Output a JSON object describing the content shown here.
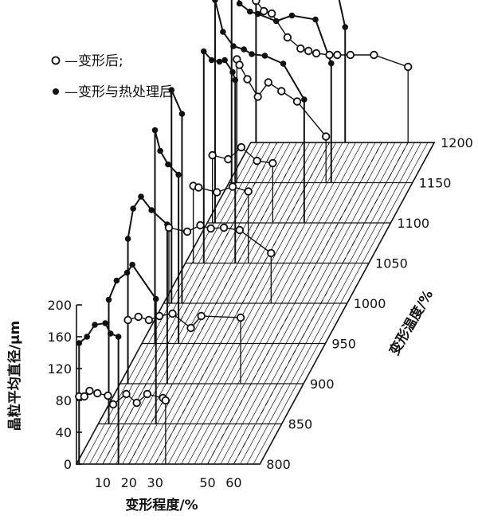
{
  "chart_data": {
    "type": "line",
    "style": "3d-waterfall",
    "grid": true,
    "legend_position": "top-left",
    "ylabel": "晶粒平均直径/μm",
    "xlabel": "变形程度/%",
    "zlabel": "变形温度/%",
    "x_ticks": [
      10,
      20,
      30,
      50,
      60
    ],
    "x_tick_labels": [
      "10",
      "20",
      "30",
      "50",
      "60"
    ],
    "y_ticks": [
      0,
      40,
      80,
      120,
      160,
      200
    ],
    "y_tick_labels": [
      "0",
      "40",
      "80",
      "120",
      "160",
      "200"
    ],
    "z_ticks": [
      800,
      850,
      900,
      950,
      1000,
      1050,
      1100,
      1150,
      1200
    ],
    "z_tick_labels": [
      "800",
      "850",
      "900",
      "950",
      "1000",
      "1050",
      "1100",
      "1150",
      "1200"
    ],
    "xlim": [
      0,
      70
    ],
    "ylim": [
      0,
      200
    ],
    "zlim": [
      800,
      1200
    ],
    "series": [
      {
        "name": "—变形后;",
        "marker": "open-circle",
        "points": [
          {
            "T": 800,
            "eps": 1,
            "d": 85
          },
          {
            "T": 800,
            "eps": 3,
            "d": 85
          },
          {
            "T": 800,
            "eps": 5,
            "d": 92
          },
          {
            "T": 800,
            "eps": 8,
            "d": 89
          },
          {
            "T": 800,
            "eps": 12,
            "d": 86
          },
          {
            "T": 800,
            "eps": 14,
            "d": 75
          },
          {
            "T": 800,
            "eps": 19,
            "d": 88
          },
          {
            "T": 800,
            "eps": 23,
            "d": 77
          },
          {
            "T": 800,
            "eps": 27,
            "d": 88
          },
          {
            "T": 800,
            "eps": 33,
            "d": 83
          },
          {
            "T": 800,
            "eps": 34,
            "d": 80
          },
          {
            "T": 900,
            "eps": 3,
            "d": 80
          },
          {
            "T": 900,
            "eps": 7,
            "d": 84
          },
          {
            "T": 900,
            "eps": 11,
            "d": 80
          },
          {
            "T": 900,
            "eps": 15,
            "d": 85
          },
          {
            "T": 900,
            "eps": 20,
            "d": 88
          },
          {
            "T": 900,
            "eps": 27,
            "d": 70
          },
          {
            "T": 900,
            "eps": 31,
            "d": 85
          },
          {
            "T": 900,
            "eps": 46,
            "d": 83
          },
          {
            "T": 1000,
            "eps": 2,
            "d": 95
          },
          {
            "T": 1000,
            "eps": 9,
            "d": 90
          },
          {
            "T": 1000,
            "eps": 14,
            "d": 98
          },
          {
            "T": 1000,
            "eps": 18,
            "d": 94
          },
          {
            "T": 1000,
            "eps": 23,
            "d": 95
          },
          {
            "T": 1000,
            "eps": 29,
            "d": 92
          },
          {
            "T": 1000,
            "eps": 41,
            "d": 63
          },
          {
            "T": 1050,
            "eps": 3,
            "d": 97
          },
          {
            "T": 1050,
            "eps": 5,
            "d": 95
          },
          {
            "T": 1050,
            "eps": 12,
            "d": 89
          },
          {
            "T": 1050,
            "eps": 18,
            "d": 96
          },
          {
            "T": 1050,
            "eps": 24,
            "d": 90
          },
          {
            "T": 1100,
            "eps": 2,
            "d": 85
          },
          {
            "T": 1100,
            "eps": 8,
            "d": 80
          },
          {
            "T": 1100,
            "eps": 13,
            "d": 95
          },
          {
            "T": 1100,
            "eps": 19,
            "d": 78
          },
          {
            "T": 1100,
            "eps": 25,
            "d": 75
          },
          {
            "T": 1150,
            "eps": 3,
            "d": 155
          },
          {
            "T": 1150,
            "eps": 4,
            "d": 148
          },
          {
            "T": 1150,
            "eps": 7,
            "d": 130
          },
          {
            "T": 1150,
            "eps": 11,
            "d": 108
          },
          {
            "T": 1150,
            "eps": 15,
            "d": 126
          },
          {
            "T": 1150,
            "eps": 20,
            "d": 115
          },
          {
            "T": 1150,
            "eps": 26,
            "d": 102
          },
          {
            "T": 1150,
            "eps": 37,
            "d": 58
          },
          {
            "T": 1200,
            "eps": 2,
            "d": 178
          },
          {
            "T": 1200,
            "eps": 5,
            "d": 165
          },
          {
            "T": 1200,
            "eps": 8,
            "d": 162
          },
          {
            "T": 1200,
            "eps": 14,
            "d": 132
          },
          {
            "T": 1200,
            "eps": 19,
            "d": 118
          },
          {
            "T": 1200,
            "eps": 22,
            "d": 115
          },
          {
            "T": 1200,
            "eps": 25,
            "d": 112
          },
          {
            "T": 1200,
            "eps": 30,
            "d": 110
          },
          {
            "T": 1200,
            "eps": 33,
            "d": 110
          },
          {
            "T": 1200,
            "eps": 38,
            "d": 110
          },
          {
            "T": 1200,
            "eps": 47,
            "d": 110
          },
          {
            "T": 1200,
            "eps": 60,
            "d": 95
          }
        ]
      },
      {
        "name": "—变形与热处理后",
        "marker": "filled-circle",
        "points": [
          {
            "T": 800,
            "eps": 1,
            "d": 152
          },
          {
            "T": 800,
            "eps": 4,
            "d": 160
          },
          {
            "T": 800,
            "eps": 7,
            "d": 175
          },
          {
            "T": 800,
            "eps": 11,
            "d": 177
          },
          {
            "T": 800,
            "eps": 13,
            "d": 164
          },
          {
            "T": 800,
            "eps": 16,
            "d": 160
          },
          {
            "T": 850,
            "eps": 4,
            "d": 156
          },
          {
            "T": 850,
            "eps": 7,
            "d": 180
          },
          {
            "T": 850,
            "eps": 11,
            "d": 190
          },
          {
            "T": 850,
            "eps": 13,
            "d": 200
          },
          {
            "T": 850,
            "eps": 22,
            "d": 157
          },
          {
            "T": 900,
            "eps": 3,
            "d": 182
          },
          {
            "T": 900,
            "eps": 5,
            "d": 220
          },
          {
            "T": 900,
            "eps": 8,
            "d": 235
          },
          {
            "T": 900,
            "eps": 12,
            "d": 218
          },
          {
            "T": 900,
            "eps": 18,
            "d": 200
          },
          {
            "T": 950,
            "eps": 5,
            "d": 268
          },
          {
            "T": 950,
            "eps": 7,
            "d": 242
          },
          {
            "T": 950,
            "eps": 10,
            "d": 225
          },
          {
            "T": 950,
            "eps": 14,
            "d": 212
          },
          {
            "T": 1000,
            "eps": 3,
            "d": 268
          },
          {
            "T": 1000,
            "eps": 7,
            "d": 238
          },
          {
            "T": 1050,
            "eps": 7,
            "d": 266
          },
          {
            "T": 1050,
            "eps": 10,
            "d": 255
          },
          {
            "T": 1050,
            "eps": 13,
            "d": 253
          },
          {
            "T": 1050,
            "eps": 15,
            "d": 255
          },
          {
            "T": 1050,
            "eps": 18,
            "d": 240
          },
          {
            "T": 1050,
            "eps": 19,
            "d": 230
          },
          {
            "T": 1100,
            "eps": 3,
            "d": 280
          },
          {
            "T": 1100,
            "eps": 6,
            "d": 240
          },
          {
            "T": 1100,
            "eps": 10,
            "d": 222
          },
          {
            "T": 1100,
            "eps": 14,
            "d": 218
          },
          {
            "T": 1100,
            "eps": 17,
            "d": 212
          },
          {
            "T": 1100,
            "eps": 22,
            "d": 210
          },
          {
            "T": 1100,
            "eps": 29,
            "d": 200
          },
          {
            "T": 1100,
            "eps": 37,
            "d": 155
          },
          {
            "T": 1150,
            "eps": 1,
            "d": 250
          },
          {
            "T": 1150,
            "eps": 2,
            "d": 255
          },
          {
            "T": 1150,
            "eps": 4,
            "d": 225
          },
          {
            "T": 1150,
            "eps": 8,
            "d": 215
          },
          {
            "T": 1150,
            "eps": 11,
            "d": 212
          },
          {
            "T": 1150,
            "eps": 18,
            "d": 203
          },
          {
            "T": 1150,
            "eps": 24,
            "d": 210
          },
          {
            "T": 1150,
            "eps": 33,
            "d": 205
          },
          {
            "T": 1150,
            "eps": 39,
            "d": 150
          },
          {
            "T": 1200,
            "eps": 2,
            "d": 295
          },
          {
            "T": 1200,
            "eps": 4,
            "d": 375
          },
          {
            "T": 1200,
            "eps": 7,
            "d": 330
          },
          {
            "T": 1200,
            "eps": 11,
            "d": 310
          },
          {
            "T": 1200,
            "eps": 16,
            "d": 290
          },
          {
            "T": 1200,
            "eps": 21,
            "d": 292
          },
          {
            "T": 1200,
            "eps": 28,
            "d": 265
          },
          {
            "T": 1200,
            "eps": 36,
            "d": 145
          }
        ]
      }
    ]
  }
}
